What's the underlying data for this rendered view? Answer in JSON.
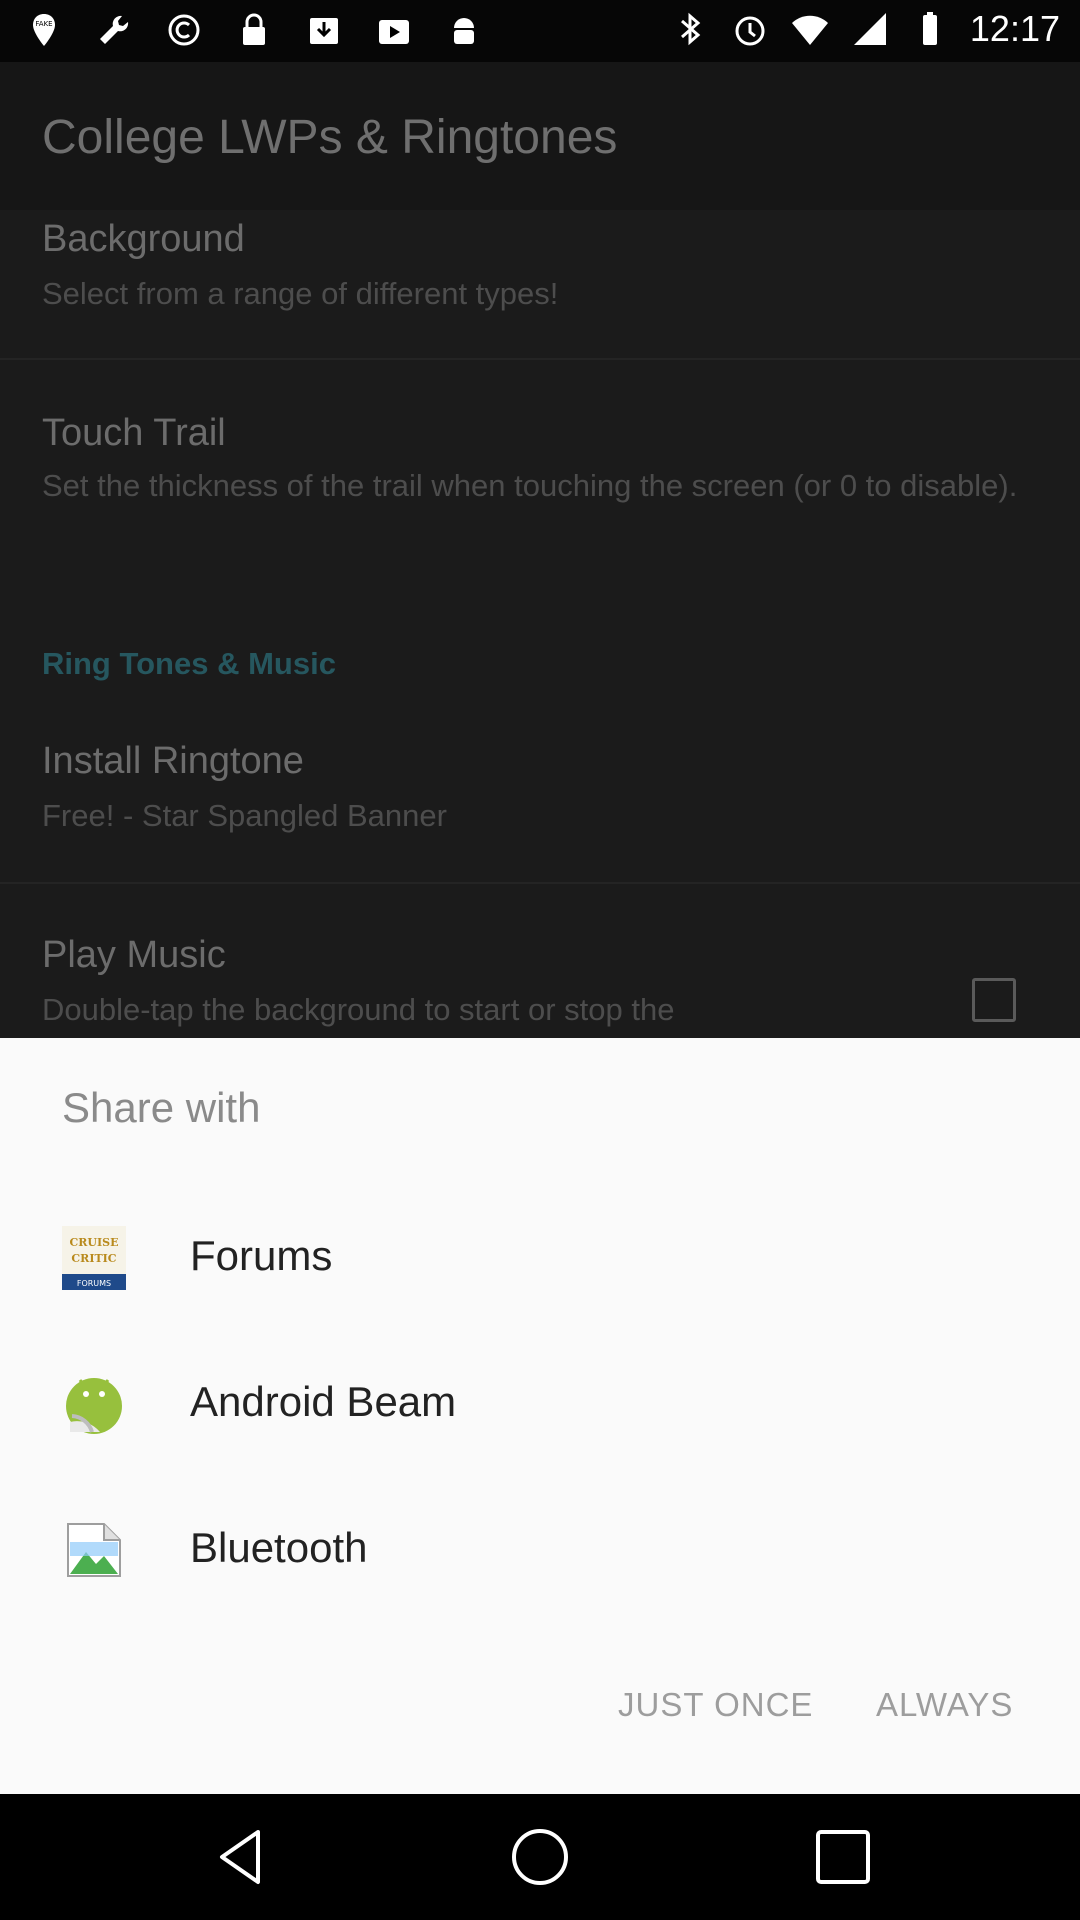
{
  "status_bar": {
    "time": "12:17",
    "left_icons": [
      "fake-gps-icon",
      "wrench-icon",
      "copyright-icon",
      "lock-icon",
      "download-icon",
      "play-store-icon",
      "android-icon"
    ],
    "right_icons": [
      "bluetooth-icon",
      "alarm-icon",
      "wifi-icon",
      "signal-icon",
      "battery-icon"
    ]
  },
  "app_bar": {
    "title": "College LWPs & Ringtones"
  },
  "preferences": [
    {
      "title": "Background",
      "summary": "Select from a range of different types!"
    },
    {
      "title": "Touch Trail",
      "summary": "Set the thickness of the trail when touching the screen (or 0 to disable)."
    },
    {
      "section": "Ring Tones & Music"
    },
    {
      "title": "Install Ringtone",
      "summary": "Free! - Star Spangled Banner"
    },
    {
      "title": "Play Music",
      "summary": "Double-tap the background to start or stop the"
    }
  ],
  "share_sheet": {
    "title": "Share with",
    "items": [
      {
        "label": "Forums",
        "icon": "cruise-critic-forums-icon",
        "icon_text": [
          "CRUISE",
          "CRITIC",
          "FORUMS"
        ]
      },
      {
        "label": "Android Beam",
        "icon": "android-beam-icon"
      },
      {
        "label": "Bluetooth",
        "icon": "broken-image-icon"
      }
    ],
    "buttons": {
      "just_once": "JUST ONCE",
      "always": "ALWAYS"
    }
  },
  "colors": {
    "accent_section": "#26575f",
    "sheet_bg": "#fafafa",
    "android_green": "#97c03d"
  }
}
